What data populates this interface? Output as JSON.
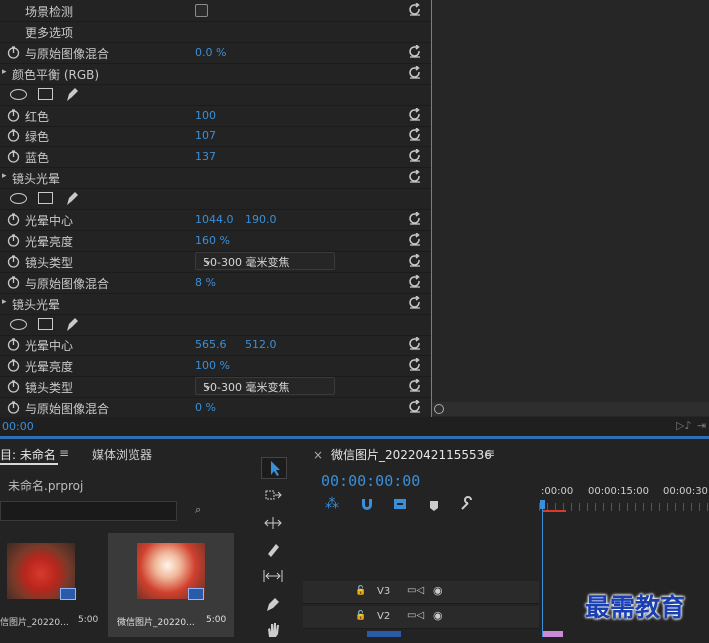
{
  "effects": {
    "rows": [
      {
        "label": "场景检测",
        "type": "checkbox"
      },
      {
        "label": "更多选项",
        "type": "text"
      },
      {
        "label": "与原始图像混合",
        "value": "0.0 %",
        "type": "param"
      },
      {
        "label": "颜色平衡 (RGB)",
        "type": "group"
      },
      {
        "type": "masks"
      },
      {
        "label": "红色",
        "value": "100",
        "type": "param"
      },
      {
        "label": "绿色",
        "value": "107",
        "type": "param"
      },
      {
        "label": "蓝色",
        "value": "137",
        "type": "param"
      },
      {
        "label": "镜头光晕",
        "type": "group"
      },
      {
        "type": "masks"
      },
      {
        "label": "光晕中心",
        "value": "1044.0",
        "value2": "190.0",
        "type": "param"
      },
      {
        "label": "光晕亮度",
        "value": "160 %",
        "type": "param"
      },
      {
        "label": "镜头类型",
        "value": "50-300 毫米变焦",
        "type": "select"
      },
      {
        "label": "与原始图像混合",
        "value": "8 %",
        "type": "param"
      },
      {
        "label": "镜头光晕",
        "type": "group"
      },
      {
        "type": "masks"
      },
      {
        "label": "光晕中心",
        "value": "565.6",
        "value2": "512.0",
        "type": "param"
      },
      {
        "label": "光晕亮度",
        "value": "100 %",
        "type": "param"
      },
      {
        "label": "镜头类型",
        "value": "50-300 毫米变焦",
        "type": "select"
      },
      {
        "label": "与原始图像混合",
        "value": "0 %",
        "type": "param"
      }
    ],
    "timecode": "00:00"
  },
  "project": {
    "tab_project": "目: 未命名",
    "tab_media_browser": "媒体浏览器",
    "project_file": "未命名.prproj",
    "items": [
      {
        "name": "信图片_20220...",
        "duration": "5:00"
      },
      {
        "name": "微信图片_20220...",
        "duration": "5:00"
      }
    ]
  },
  "sequence": {
    "close": "×",
    "title": "微信图片_20220421155536",
    "timecode": "00:00:00:00",
    "ruler": [
      ":00:00",
      "00:00:15:00",
      "00:00:30:"
    ],
    "tracks": [
      {
        "name": "V3"
      },
      {
        "name": "V2"
      }
    ]
  },
  "watermark": "最需教育",
  "colors": {
    "accent": "#3a8fd8",
    "value_text": "#3a8fd8",
    "background": "#232323"
  }
}
